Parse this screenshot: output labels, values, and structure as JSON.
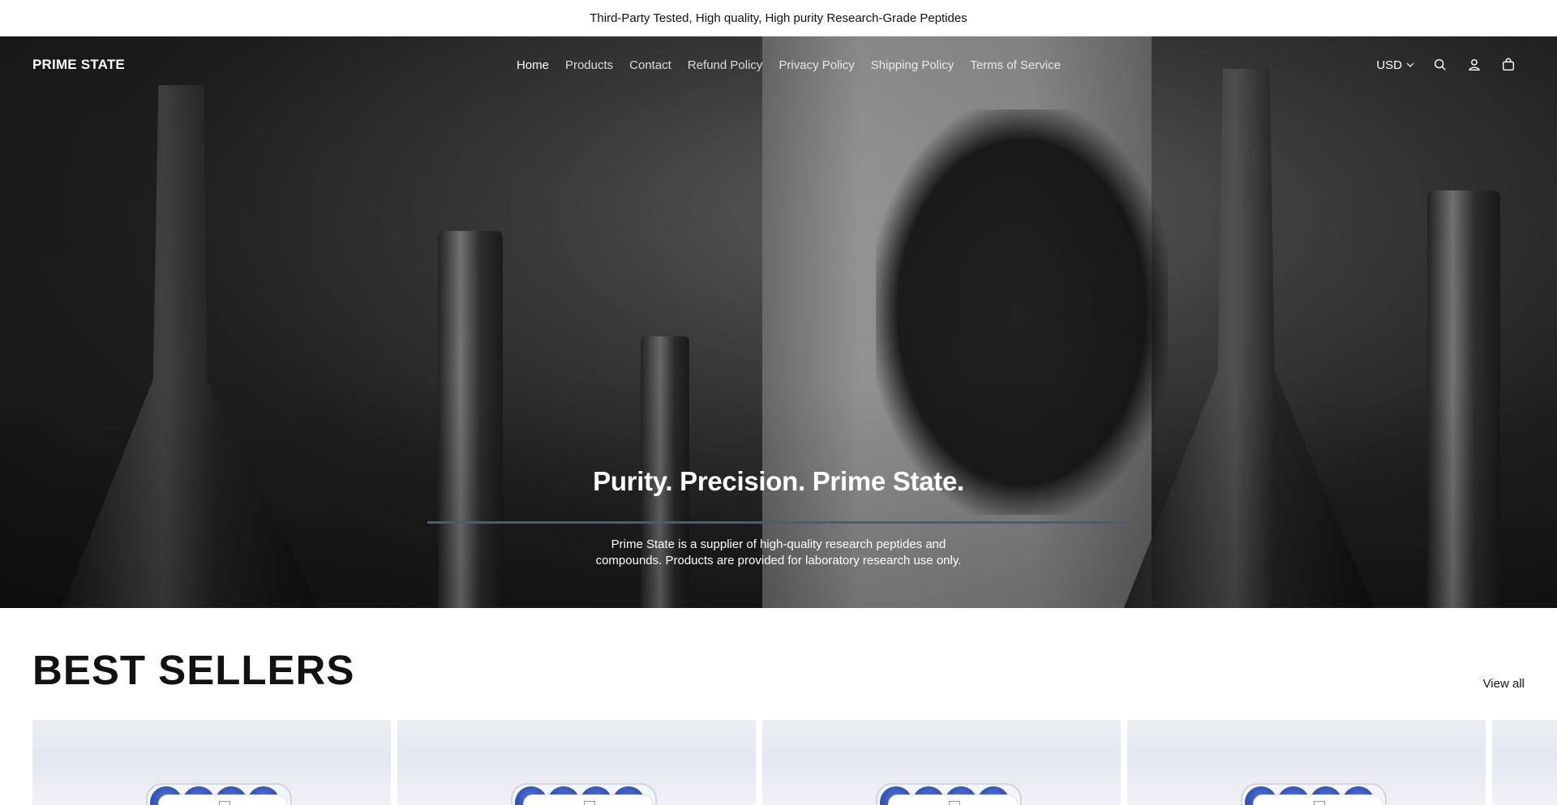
{
  "announcement": {
    "text": "Third-Party Tested, High quality, High purity Research-Grade Peptides"
  },
  "header": {
    "logo": "PRIME STATE",
    "nav": [
      {
        "label": "Home",
        "active": true
      },
      {
        "label": "Products"
      },
      {
        "label": "Contact"
      },
      {
        "label": "Refund Policy"
      },
      {
        "label": "Privacy Policy"
      },
      {
        "label": "Shipping Policy"
      },
      {
        "label": "Terms of Service"
      }
    ],
    "currency": "USD",
    "icons": [
      "search-icon",
      "account-icon",
      "cart-icon",
      "chevron-down-icon"
    ]
  },
  "hero": {
    "title": "Purity. Precision. Prime State.",
    "description": "Prime State is a supplier of high-quality research peptides and compounds. Products are provided for laboratory research use only.",
    "rule_color": "#4c5a80"
  },
  "best_sellers": {
    "title": "BEST SELLERS",
    "view_all": "View all"
  },
  "colors": {
    "accent": "#4c5a80",
    "text": "#121212",
    "background": "#ffffff",
    "vial": "#2e4fb5"
  }
}
